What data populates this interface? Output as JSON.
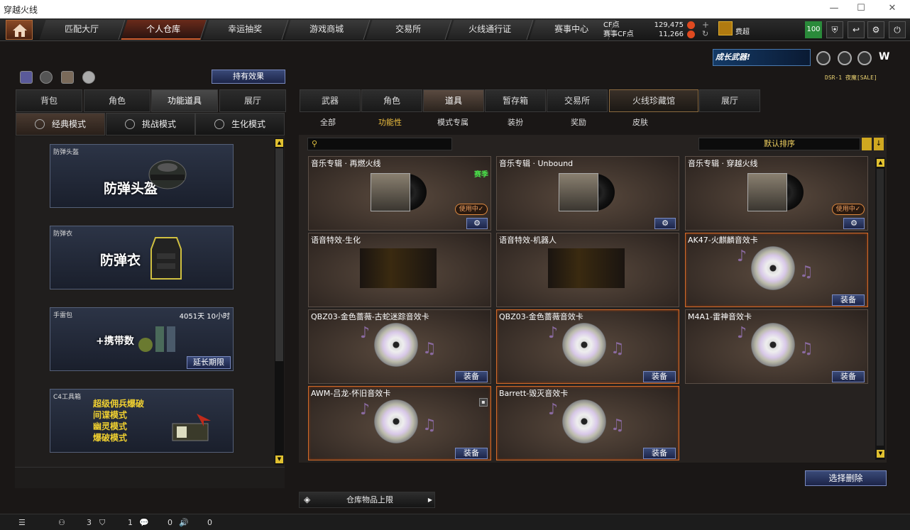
{
  "window": {
    "title": "穿越火线"
  },
  "nav": {
    "tabs": [
      "匹配大厅",
      "个人仓库",
      "幸运抽奖",
      "游戏商城",
      "交易所",
      "火线通行证",
      "赛事中心"
    ],
    "active": 1
  },
  "currency": {
    "cf_label": "CF点",
    "cf_value": "129,475",
    "match_label": "赛事CF点",
    "match_value": "11,266"
  },
  "user": {
    "name": "费超",
    "level": "100"
  },
  "banner": {
    "text": "成长武器!"
  },
  "build": {
    "text": "DSR-1 夜魔[SALE]"
  },
  "left": {
    "effect_button": "持有效果",
    "tabs": [
      "背包",
      "角色",
      "功能道具",
      "展厅"
    ],
    "modes": [
      "经典模式",
      "挑战模式",
      "生化模式"
    ],
    "cards": [
      {
        "category": "防弹头盔",
        "title": "防弹头盔"
      },
      {
        "category": "防弹衣",
        "title": "防弹衣"
      },
      {
        "category": "手雷包",
        "title": "+携带数",
        "time": "4051天 10小时",
        "extend": "延长期限"
      },
      {
        "category": "C4工具箱",
        "modes": [
          "超级佣兵爆破",
          "间谍模式",
          "幽灵模式",
          "爆破模式"
        ]
      }
    ]
  },
  "right": {
    "tabs": [
      "武器",
      "角色",
      "道具",
      "暂存箱",
      "交易所",
      "火线珍藏馆",
      "展厅"
    ],
    "subtabs": [
      "全部",
      "功能性",
      "模式专属",
      "装扮",
      "奖励",
      "皮肤"
    ],
    "sort_label": "默认排序",
    "items": [
      {
        "name": "音乐专辑 · 再燃火线",
        "season": "赛季",
        "status": "使用中✓",
        "action": "⚙",
        "kind": "album",
        "orange": false
      },
      {
        "name": "音乐专辑 · Unbound",
        "action": "⚙",
        "kind": "album",
        "orange": false
      },
      {
        "name": "音乐专辑 · 穿越火线",
        "status": "使用中✓",
        "action": "⚙",
        "kind": "album",
        "orange": false
      },
      {
        "name": "语音特效-生化",
        "kind": "voice",
        "orange": false
      },
      {
        "name": "语音特效-机器人",
        "kind": "voice",
        "orange": false
      },
      {
        "name": "AK47-火麒麟音效卡",
        "action": "装备",
        "kind": "disc",
        "orange": true
      },
      {
        "name": "QBZ03-金色蔷薇-古蛇迷踪音效卡",
        "action": "装备",
        "kind": "disc",
        "orange": false
      },
      {
        "name": "QBZ03-金色蔷薇音效卡",
        "action": "装备",
        "kind": "disc",
        "orange": true
      },
      {
        "name": "M4A1-雷神音效卡",
        "action": "装备",
        "kind": "disc",
        "orange": false
      },
      {
        "name": "AWM-吕龙-怀旧音效卡",
        "action": "装备",
        "kind": "disc",
        "orange": true,
        "locked": true
      },
      {
        "name": "Barrett-毁灭音效卡",
        "action": "装备",
        "kind": "disc",
        "orange": true
      }
    ],
    "delete_button": "选择删除",
    "capacity_label": "仓库物品上限"
  },
  "status": {
    "friends": "3",
    "clan": "1",
    "chat": "0",
    "voice": "0"
  }
}
